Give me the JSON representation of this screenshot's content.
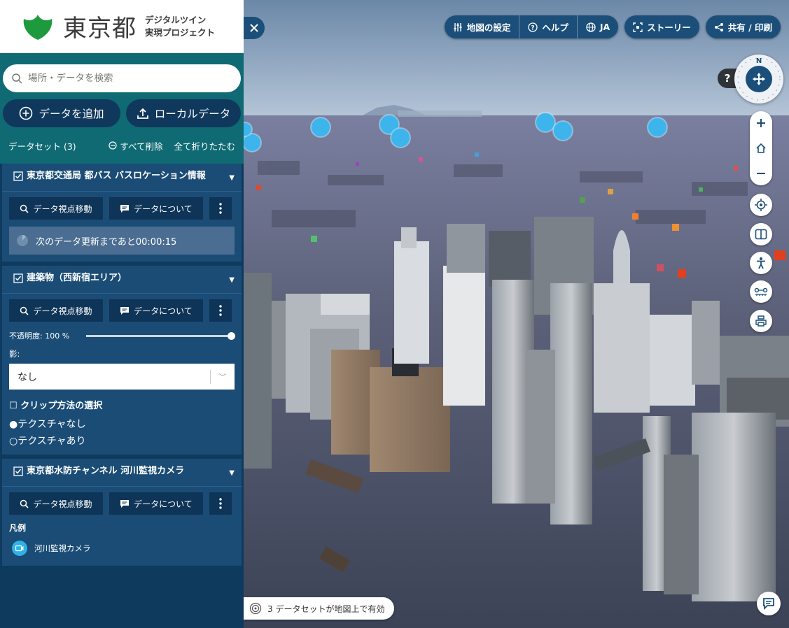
{
  "logo": {
    "name": "東京都",
    "subtitle_line1": "デジタルツイン",
    "subtitle_line2": "実現プロジェクト"
  },
  "search": {
    "placeholder": "場所・データを検索"
  },
  "actions": {
    "add_data": "データを追加",
    "local_data": "ローカルデータ"
  },
  "datasets": {
    "count_label": "データセット (3)",
    "delete_all": "すべて削除",
    "collapse_all": "全て折りたたむ"
  },
  "cards": [
    {
      "title": "東京都交通局 都バス バスロケーション情報",
      "move": "データ視点移動",
      "about": "データについて",
      "timer": "次のデータ更新まであと00:00:15"
    },
    {
      "title": "建築物（西新宿エリア）",
      "move": "データ視点移動",
      "about": "データについて",
      "opacity": "不透明度: 100 %",
      "opacity_value": 1.0,
      "shadow_label": "影:",
      "shadow_value": "なし",
      "clip_label": "クリップ方法の選択",
      "radio1": "テクスチャなし",
      "radio2": "テクスチャあり"
    },
    {
      "title": "東京都水防チャンネル 河川監視カメラ",
      "move": "データ視点移動",
      "about": "データについて",
      "legend_title": "凡例",
      "legend_item": "河川監視カメラ"
    }
  ],
  "topbar": {
    "map_settings": "地図の設定",
    "help": "ヘルプ",
    "language": "JA",
    "story": "ストーリー",
    "share": "共有 / 印刷"
  },
  "compass": {
    "north": "N"
  },
  "help_q": "?",
  "status": "3 データセットが地図上で有効",
  "colors": {
    "sidebar": "#0e3a5e",
    "teal": "#0f6a73",
    "card": "#1a4c76",
    "button": "#1b4f7a",
    "logo_green": "#1d9a3e",
    "camera": "#2fb2e6"
  },
  "icons": [
    "search-icon",
    "plus-circle-icon",
    "upload-icon",
    "minus-circle-icon",
    "checkbox-icon",
    "caret-down-icon",
    "magnifier-icon",
    "info-card-icon",
    "kebab-icon",
    "clock-icon",
    "sliders-icon",
    "help-circle-icon",
    "globe-icon",
    "story-icon",
    "share-icon",
    "close-icon",
    "compass-icon",
    "zoom-in-icon",
    "home-icon",
    "zoom-out-icon",
    "locate-icon",
    "split-view-icon",
    "pedestrian-icon",
    "measure-icon",
    "print-icon",
    "chat-icon",
    "camera-icon",
    "datasets-icon"
  ]
}
